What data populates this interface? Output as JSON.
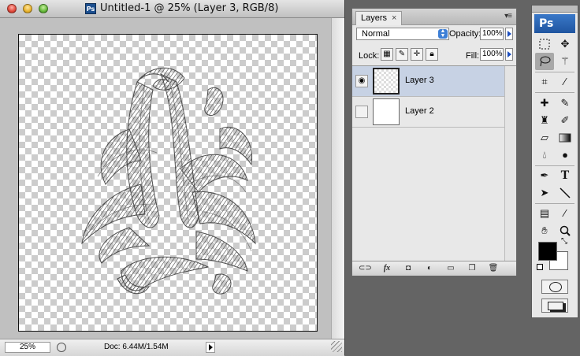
{
  "document": {
    "title": "Untitled-1 @ 25% (Layer 3, RGB/8)",
    "app_badge": "Ps",
    "zoom": "25%",
    "doc_info": "Doc: 6.44M/1.54M"
  },
  "layers_panel": {
    "tab_label": "Layers",
    "tab_close": "×",
    "blend_mode": "Normal",
    "opacity_label": "Opacity:",
    "opacity_value": "100%",
    "lock_label": "Lock:",
    "fill_label": "Fill:",
    "fill_value": "100%",
    "layers": [
      {
        "name": "Layer 3",
        "visible": true,
        "selected": true
      },
      {
        "name": "Layer 2",
        "visible": false,
        "selected": false
      }
    ],
    "bottom_icons": [
      "link-icon",
      "fx-icon",
      "mask-icon",
      "adjustment-icon",
      "group-icon",
      "new-layer-icon",
      "trash-icon"
    ],
    "fx_label": "fx"
  },
  "tools_panel": {
    "logo": "Ps",
    "colors": {
      "foreground": "#000000",
      "background": "#ffffff"
    },
    "tools": [
      "marquee-icon",
      "move-icon",
      "lasso-icon",
      "magic-wand-icon",
      "crop-icon",
      "eyedropper-icon",
      "healing-icon",
      "brush-icon",
      "clone-stamp-icon",
      "history-brush-icon",
      "eraser-icon",
      "gradient-icon",
      "blur-icon",
      "dodge-icon",
      "pen-icon",
      "type-icon",
      "path-select-icon",
      "line-icon",
      "notes-icon",
      "eyedropper2-icon",
      "hand-icon",
      "zoom-icon"
    ],
    "type_tool_glyph": "T"
  }
}
